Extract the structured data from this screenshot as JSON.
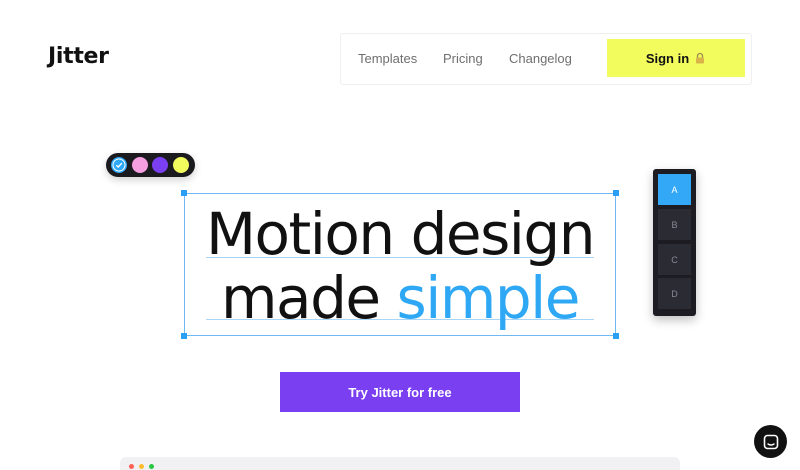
{
  "brand": {
    "name": "Jitter"
  },
  "nav": {
    "links": [
      "Templates",
      "Pricing",
      "Changelog"
    ],
    "signin_label": "Sign in",
    "signin_icon": "lock-icon",
    "signin_color": "#f2fc5d"
  },
  "swatches": {
    "colors": [
      "#2ea8f5",
      "#f59ee0",
      "#7b3ff2",
      "#f2fc5d"
    ],
    "selected": "#2ea8f5",
    "selected_icon": "check-icon"
  },
  "hero": {
    "line1": "Motion design",
    "line2_plain": "made",
    "line2_accent": "simple",
    "accent_color": "#2ea8f5"
  },
  "layers_panel": {
    "items": [
      "A",
      "B",
      "C",
      "D"
    ],
    "active": "A"
  },
  "cta": {
    "label": "Try Jitter for free",
    "color": "#7b3ff2"
  },
  "preview": {
    "window_dots": [
      "#ff5f57",
      "#febc2e",
      "#28c840"
    ]
  },
  "chat": {
    "icon": "chat-icon"
  }
}
